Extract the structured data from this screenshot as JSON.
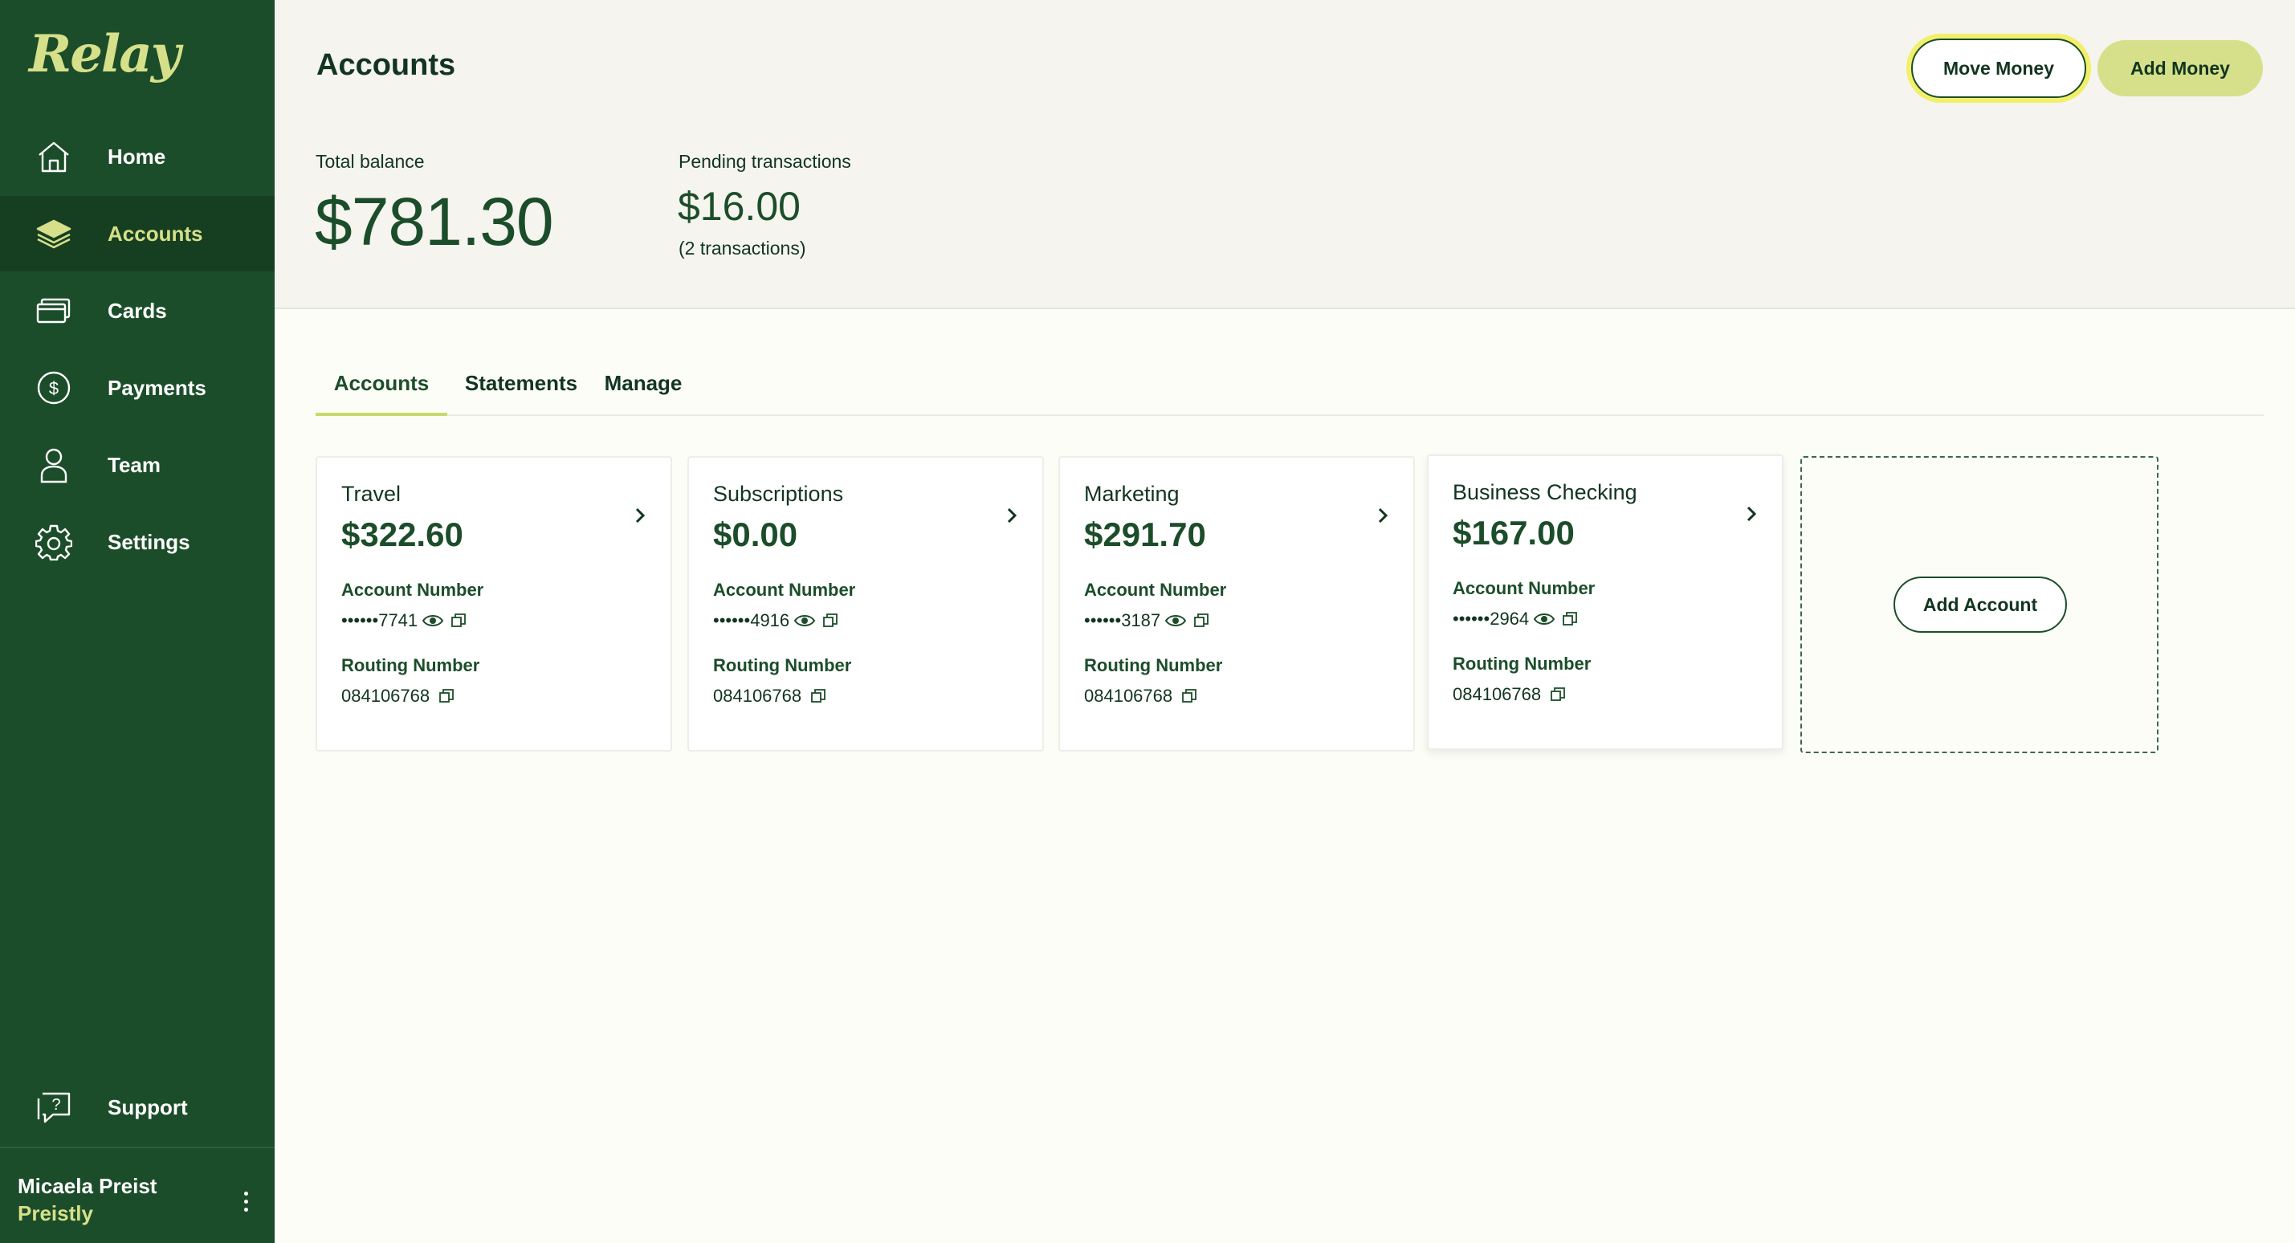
{
  "brand": {
    "logo_text": "Relay",
    "accent": "#d6e08a",
    "sidebar_bg": "#1c4d2a"
  },
  "sidebar": {
    "items": [
      {
        "label": "Home",
        "icon": "home-icon"
      },
      {
        "label": "Accounts",
        "icon": "layers-icon",
        "active": true
      },
      {
        "label": "Cards",
        "icon": "cards-icon"
      },
      {
        "label": "Payments",
        "icon": "dollar-circle-icon"
      },
      {
        "label": "Team",
        "icon": "person-icon"
      },
      {
        "label": "Settings",
        "icon": "gear-icon"
      }
    ],
    "support": {
      "label": "Support",
      "icon": "support-chat-icon"
    },
    "user": {
      "name": "Micaela Preist",
      "org": "Preistly"
    }
  },
  "header": {
    "title": "Accounts",
    "move_money": "Move Money",
    "add_money": "Add Money"
  },
  "summary": {
    "total_label": "Total balance",
    "total_value": "$781.30",
    "pending_label": "Pending transactions",
    "pending_value": "$16.00",
    "pending_count": "(2 transactions)"
  },
  "tabs": [
    {
      "label": "Accounts",
      "active": true
    },
    {
      "label": "Statements"
    },
    {
      "label": "Manage"
    }
  ],
  "accounts": [
    {
      "name": "Travel",
      "balance": "$322.60",
      "account_label": "Account Number",
      "account_number": "••••••7741",
      "routing_label": "Routing Number",
      "routing_number": "084106768"
    },
    {
      "name": "Subscriptions",
      "balance": "$0.00",
      "account_label": "Account Number",
      "account_number": "••••••4916",
      "routing_label": "Routing Number",
      "routing_number": "084106768"
    },
    {
      "name": "Marketing",
      "balance": "$291.70",
      "account_label": "Account Number",
      "account_number": "••••••3187",
      "routing_label": "Routing Number",
      "routing_number": "084106768"
    },
    {
      "name": "Business Checking",
      "balance": "$167.00",
      "account_label": "Account Number",
      "account_number": "••••••2964",
      "routing_label": "Routing Number",
      "routing_number": "084106768"
    }
  ],
  "add_account": {
    "label": "Add Account"
  }
}
